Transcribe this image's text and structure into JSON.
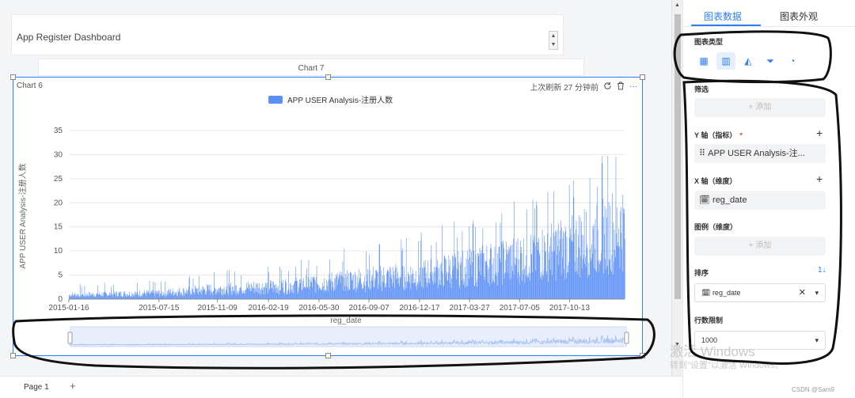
{
  "dashboard": {
    "title": "App Register Dashboard",
    "stepper_up": "▲",
    "stepper_down": "▼"
  },
  "chart7": {
    "title": "Chart 7"
  },
  "chart6": {
    "title": "Chart 6",
    "refresh_text": "上次刷新 27 分钟前",
    "refresh_icon": "refresh-icon",
    "delete_icon": "trash-icon",
    "more_label": "···"
  },
  "chart_data": {
    "type": "bar",
    "legend": [
      "APP USER Analysis-注册人数"
    ],
    "series": [
      {
        "name": "APP USER Analysis-注册人数",
        "color": "#5b8ff9"
      }
    ],
    "xlabel": "reg_date",
    "ylabel": "APP USER Analysis-注册人数",
    "ylim": [
      0,
      35
    ],
    "yticks": [
      0,
      5,
      10,
      15,
      20,
      25,
      30,
      35
    ],
    "x_range": [
      "2015-01-16",
      "2018-01-31"
    ],
    "xticks": [
      "2015-01-16",
      "2015-07-15",
      "2015-11-09",
      "2016-02-19",
      "2016-05-30",
      "2016-09-07",
      "2016-12-17",
      "2017-03-27",
      "2017-07-05",
      "2017-10-13"
    ],
    "trend_approx": [
      {
        "date": "2015-01-16",
        "typical": 1,
        "max": 3
      },
      {
        "date": "2015-07-15",
        "typical": 1.5,
        "max": 4
      },
      {
        "date": "2015-11-09",
        "typical": 2.5,
        "max": 6
      },
      {
        "date": "2016-02-19",
        "typical": 3,
        "max": 7
      },
      {
        "date": "2016-05-30",
        "typical": 4,
        "max": 9
      },
      {
        "date": "2016-09-07",
        "typical": 5,
        "max": 12
      },
      {
        "date": "2016-12-17",
        "typical": 6,
        "max": 14
      },
      {
        "date": "2017-03-27",
        "typical": 8,
        "max": 18
      },
      {
        "date": "2017-07-05",
        "typical": 10,
        "max": 22
      },
      {
        "date": "2017-10-13",
        "typical": 13,
        "max": 26
      },
      {
        "date": "2018-01-31",
        "typical": 18,
        "max": 33
      }
    ],
    "grid": true,
    "legend_position": "top-center",
    "data_zoom": true
  },
  "page_tabs": {
    "page1": "Page 1",
    "add": "+"
  },
  "panel": {
    "tabs": [
      "图表数据",
      "图表外观"
    ],
    "chart_type_label": "图表类型",
    "chart_types": [
      {
        "icon": "table-icon",
        "glyph": "▦"
      },
      {
        "icon": "bar-chart-icon",
        "glyph": "▥",
        "active": true
      },
      {
        "icon": "area-chart-icon",
        "glyph": "◭"
      },
      {
        "icon": "funnel-icon",
        "glyph": "⏷"
      },
      {
        "icon": "pie-chart-icon",
        "glyph": "◔"
      }
    ],
    "filter_label": "筛选",
    "filter_add": "+ 添加",
    "y_axis_label": "Y 轴（指标）",
    "y_required": "*",
    "y_field": "⠿ APP USER Analysis-注...",
    "x_axis_label": "X 轴（维度）",
    "x_field": "reg_date",
    "legend_label": "图例（维度）",
    "legend_add": "+ 添加",
    "sort_label": "排序",
    "sort_toggle": "1↓",
    "sort_field": "reg_date",
    "limit_label": "行数限制",
    "limit_value": "1000",
    "plus": "+"
  },
  "watermark": {
    "activate": "激活 Windows",
    "sub": "转到\"设置\"以激活 Windows。",
    "csdn": "CSDN @Sam9"
  }
}
